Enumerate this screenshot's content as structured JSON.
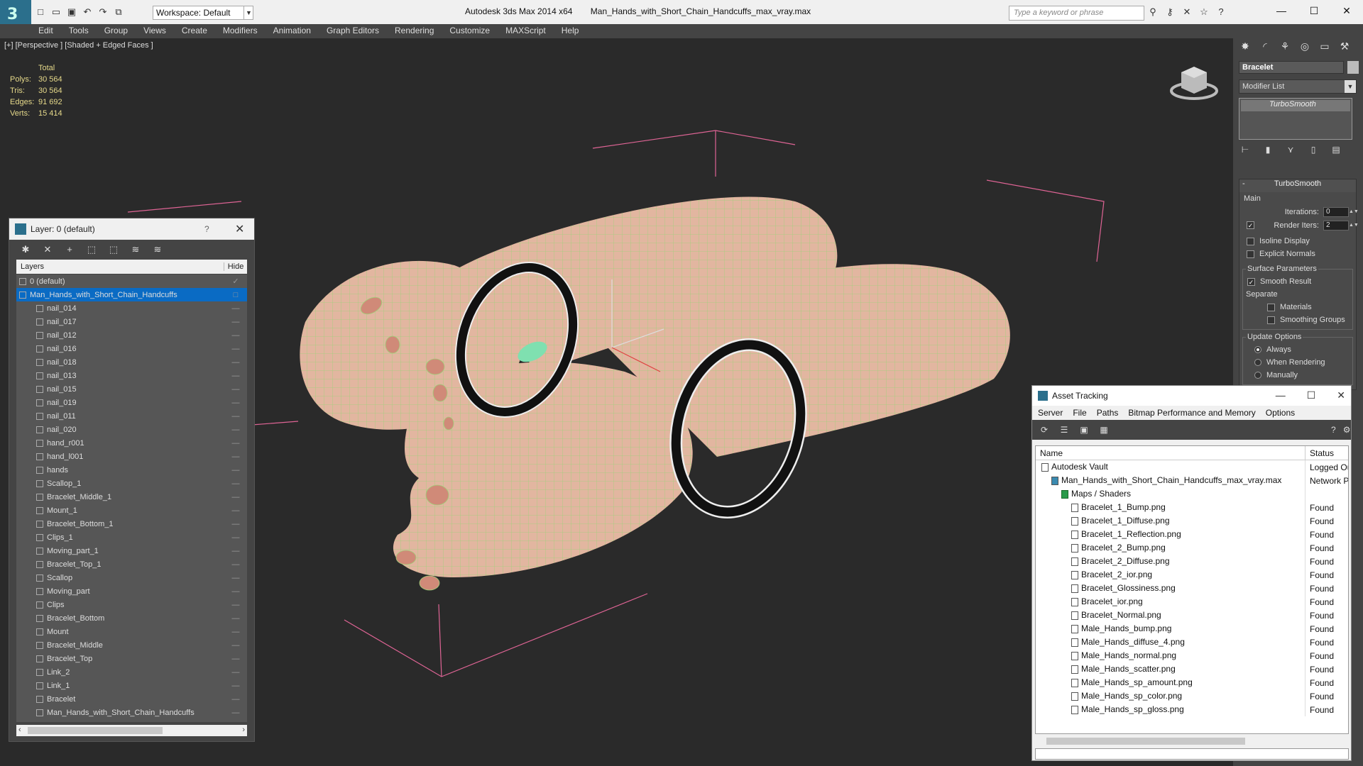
{
  "title_bar": {
    "app": "Autodesk 3ds Max  2014 x64",
    "file": "Man_Hands_with_Short_Chain_Handcuffs_max_vray.max",
    "workspace": "Workspace: Default",
    "search_placeholder": "Type a keyword or phrase"
  },
  "menu": [
    "Edit",
    "Tools",
    "Group",
    "Views",
    "Create",
    "Modifiers",
    "Animation",
    "Graph Editors",
    "Rendering",
    "Customize",
    "MAXScript",
    "Help"
  ],
  "viewport": {
    "label": "[+] [Perspective ] [Shaded + Edged Faces ]",
    "stats": {
      "header": "Total",
      "rows": [
        {
          "k": "Polys:",
          "v": "30 564"
        },
        {
          "k": "Tris:",
          "v": "30 564"
        },
        {
          "k": "Edges:",
          "v": "91 692"
        },
        {
          "k": "Verts:",
          "v": "15 414"
        }
      ]
    }
  },
  "layer_panel": {
    "title": "Layer: 0 (default)",
    "help": "?",
    "col_layers": "Layers",
    "col_hide": "Hide",
    "layers": [
      {
        "name": "0 (default)",
        "level": 0
      },
      {
        "name": "Man_Hands_with_Short_Chain_Handcuffs",
        "level": 0,
        "selected": true
      }
    ],
    "objects": [
      "nail_014",
      "nail_017",
      "nail_012",
      "nail_016",
      "nail_018",
      "nail_013",
      "nail_015",
      "nail_019",
      "nail_011",
      "nail_020",
      "hand_r001",
      "hand_l001",
      "hands",
      "Scallop_1",
      "Bracelet_Middle_1",
      "Mount_1",
      "Bracelet_Bottom_1",
      "Clips_1",
      "Moving_part_1",
      "Bracelet_Top_1",
      "Scallop",
      "Moving_part",
      "Clips",
      "Bracelet_Bottom",
      "Mount",
      "Bracelet_Middle",
      "Bracelet_Top",
      "Link_2",
      "Link_1",
      "Bracelet",
      "Man_Hands_with_Short_Chain_Handcuffs"
    ]
  },
  "command_panel": {
    "object_name": "Bracelet",
    "modifier_list": "Modifier List",
    "stack_item": "TurboSmooth",
    "rollout_title": "TurboSmooth",
    "main_label": "Main",
    "iterations_label": "Iterations:",
    "iterations_value": "0",
    "render_iters_label": "Render Iters:",
    "render_iters_value": "2",
    "isoline": "Isoline Display",
    "explicit": "Explicit Normals",
    "surface_params": "Surface Parameters",
    "smooth_result": "Smooth Result",
    "separate": "Separate",
    "materials": "Materials",
    "smoothing_groups": "Smoothing Groups",
    "update_options": "Update Options",
    "always": "Always",
    "when_rendering": "When Rendering",
    "manually": "Manually"
  },
  "asset_tracking": {
    "title": "Asset Tracking",
    "menu": [
      "Server",
      "File",
      "Paths",
      "Bitmap Performance and Memory",
      "Options"
    ],
    "col_name": "Name",
    "col_status": "Status",
    "rows": [
      {
        "name": "Autodesk Vault",
        "status": "Logged Ou",
        "indent": 0,
        "kind": "vault"
      },
      {
        "name": "Man_Hands_with_Short_Chain_Handcuffs_max_vray.max",
        "status": "Network P",
        "indent": 1,
        "kind": "max"
      },
      {
        "name": "Maps / Shaders",
        "status": "",
        "indent": 2,
        "kind": "maps"
      },
      {
        "name": "Bracelet_1_Bump.png",
        "status": "Found",
        "indent": 3,
        "kind": "file"
      },
      {
        "name": "Bracelet_1_Diffuse.png",
        "status": "Found",
        "indent": 3,
        "kind": "file"
      },
      {
        "name": "Bracelet_1_Reflection.png",
        "status": "Found",
        "indent": 3,
        "kind": "file"
      },
      {
        "name": "Bracelet_2_Bump.png",
        "status": "Found",
        "indent": 3,
        "kind": "file"
      },
      {
        "name": "Bracelet_2_Diffuse.png",
        "status": "Found",
        "indent": 3,
        "kind": "file"
      },
      {
        "name": "Bracelet_2_ior.png",
        "status": "Found",
        "indent": 3,
        "kind": "file"
      },
      {
        "name": "Bracelet_Glossiness.png",
        "status": "Found",
        "indent": 3,
        "kind": "file"
      },
      {
        "name": "Bracelet_ior.png",
        "status": "Found",
        "indent": 3,
        "kind": "file"
      },
      {
        "name": "Bracelet_Normal.png",
        "status": "Found",
        "indent": 3,
        "kind": "file"
      },
      {
        "name": "Male_Hands_bump.png",
        "status": "Found",
        "indent": 3,
        "kind": "file"
      },
      {
        "name": "Male_Hands_diffuse_4.png",
        "status": "Found",
        "indent": 3,
        "kind": "file"
      },
      {
        "name": "Male_Hands_normal.png",
        "status": "Found",
        "indent": 3,
        "kind": "file"
      },
      {
        "name": "Male_Hands_scatter.png",
        "status": "Found",
        "indent": 3,
        "kind": "file"
      },
      {
        "name": "Male_Hands_sp_amount.png",
        "status": "Found",
        "indent": 3,
        "kind": "file"
      },
      {
        "name": "Male_Hands_sp_color.png",
        "status": "Found",
        "indent": 3,
        "kind": "file"
      },
      {
        "name": "Male_Hands_sp_gloss.png",
        "status": "Found",
        "indent": 3,
        "kind": "file"
      }
    ]
  },
  "colors": {
    "accent": "#0a6bc4",
    "stats": "#e6d98a",
    "skin": "#e8b8a0",
    "wire": "#a8e07a",
    "grid_guides": "#ff6fa8"
  }
}
